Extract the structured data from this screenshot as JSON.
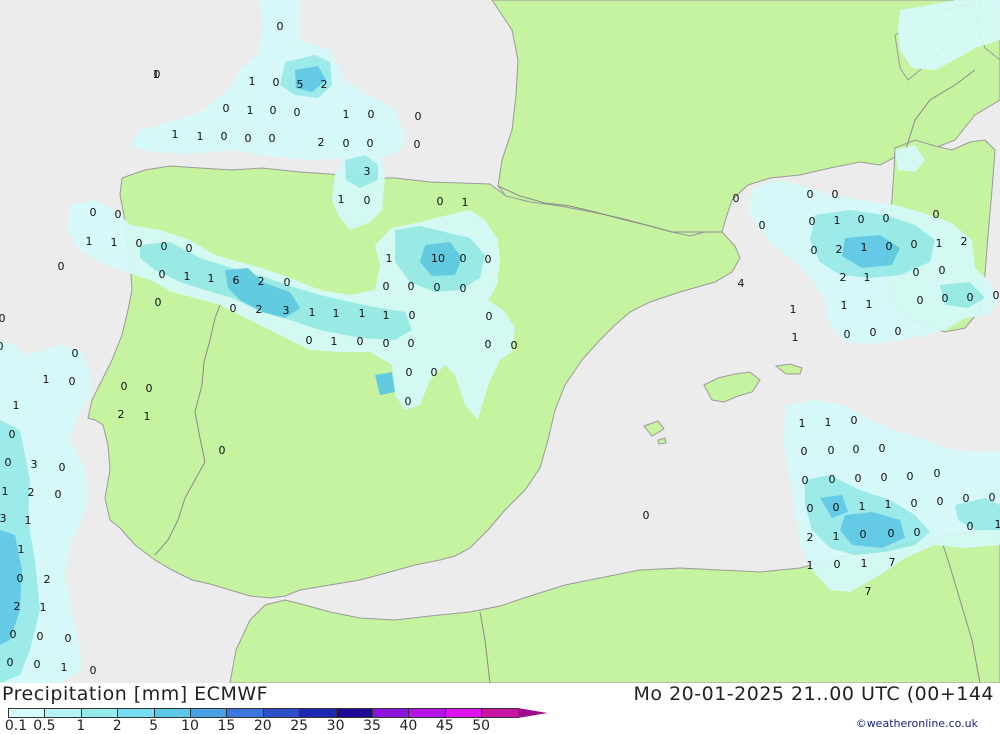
{
  "title": "Precipitation [mm] ECMWF",
  "datetime": "Mo 20-01-2025 21..00 UTC (00+144",
  "credit": "©weatheronline.co.uk",
  "colors": {
    "sea": "#ececec",
    "land": "#c6f3a0",
    "coast": "#9a9a9a",
    "border": "#8a8a8a"
  },
  "legend": {
    "ticks": [
      "0.1",
      "0.5",
      "1",
      "2",
      "5",
      "10",
      "15",
      "20",
      "25",
      "30",
      "35",
      "40",
      "45",
      "50"
    ],
    "colors": [
      "#d6fafa",
      "#b4f3f3",
      "#96eaea",
      "#78dcf0",
      "#5ac8e6",
      "#4aa0e6",
      "#3c78dc",
      "#2d50c8",
      "#1e28b4",
      "#1e0a96",
      "#8c14dc",
      "#b414e6",
      "#dc14f0",
      "#c814a0",
      "#a00a8c"
    ]
  },
  "labels": [
    {
      "t": "0"
    },
    {
      "t": "0"
    },
    {
      "t": "1"
    },
    {
      "t": "0"
    },
    {
      "t": "5"
    },
    {
      "t": "2"
    },
    {
      "t": "0"
    },
    {
      "t": "1"
    },
    {
      "t": "0"
    },
    {
      "t": "0"
    },
    {
      "t": "1"
    },
    {
      "t": "0"
    },
    {
      "t": "0"
    },
    {
      "t": "1"
    },
    {
      "t": "1"
    },
    {
      "t": "0"
    },
    {
      "t": "0"
    },
    {
      "t": "0"
    },
    {
      "t": "2"
    },
    {
      "t": "0"
    },
    {
      "t": "0"
    },
    {
      "t": "0"
    },
    {
      "t": "3"
    },
    {
      "t": "1"
    },
    {
      "t": "0"
    },
    {
      "t": "0"
    },
    {
      "t": "1"
    },
    {
      "t": "0"
    },
    {
      "t": "0"
    },
    {
      "t": "1"
    },
    {
      "t": "1"
    },
    {
      "t": "0"
    },
    {
      "t": "0"
    },
    {
      "t": "0"
    },
    {
      "t": "0"
    },
    {
      "t": "1"
    },
    {
      "t": "10"
    },
    {
      "t": "0"
    },
    {
      "t": "0"
    },
    {
      "t": "0"
    },
    {
      "t": "1"
    },
    {
      "t": "1"
    },
    {
      "t": "6"
    },
    {
      "t": "2"
    },
    {
      "t": "0"
    },
    {
      "t": "0"
    },
    {
      "t": "0"
    },
    {
      "t": "0"
    },
    {
      "t": "0"
    },
    {
      "t": "0"
    },
    {
      "t": "0"
    },
    {
      "t": "2"
    },
    {
      "t": "3"
    },
    {
      "t": "1"
    },
    {
      "t": "1"
    },
    {
      "t": "1"
    },
    {
      "t": "1"
    },
    {
      "t": "0"
    },
    {
      "t": "0"
    },
    {
      "t": "0"
    },
    {
      "t": "0"
    },
    {
      "t": "0"
    },
    {
      "t": "1"
    },
    {
      "t": "0"
    },
    {
      "t": "0"
    },
    {
      "t": "0"
    },
    {
      "t": "0"
    },
    {
      "t": "0"
    },
    {
      "t": "0"
    },
    {
      "t": "1"
    },
    {
      "t": "0"
    },
    {
      "t": "0"
    },
    {
      "t": "0"
    },
    {
      "t": "0"
    },
    {
      "t": "0"
    },
    {
      "t": "0"
    },
    {
      "t": "1"
    },
    {
      "t": "2"
    },
    {
      "t": "1"
    },
    {
      "t": "0"
    },
    {
      "t": "0"
    },
    {
      "t": "0"
    },
    {
      "t": "3"
    },
    {
      "t": "0"
    },
    {
      "t": "1"
    },
    {
      "t": "2"
    },
    {
      "t": "0"
    },
    {
      "t": "3"
    },
    {
      "t": "1"
    },
    {
      "t": "1"
    },
    {
      "t": "0"
    },
    {
      "t": "2"
    },
    {
      "t": "2"
    },
    {
      "t": "1"
    },
    {
      "t": "0"
    },
    {
      "t": "0"
    },
    {
      "t": "0"
    },
    {
      "t": "0"
    },
    {
      "t": "0"
    },
    {
      "t": "1"
    },
    {
      "t": "0"
    },
    {
      "t": "1"
    },
    {
      "t": "0"
    },
    {
      "t": "0"
    },
    {
      "t": "0"
    },
    {
      "t": "0"
    },
    {
      "t": "0"
    },
    {
      "t": "1"
    },
    {
      "t": "0"
    },
    {
      "t": "0"
    },
    {
      "t": "0"
    },
    {
      "t": "0"
    },
    {
      "t": "2"
    },
    {
      "t": "1"
    },
    {
      "t": "0"
    },
    {
      "t": "0"
    },
    {
      "t": "1"
    },
    {
      "t": "2"
    },
    {
      "t": "4"
    },
    {
      "t": "2"
    },
    {
      "t": "1"
    },
    {
      "t": "0"
    },
    {
      "t": "0"
    },
    {
      "t": "1"
    },
    {
      "t": "1"
    },
    {
      "t": "1"
    },
    {
      "t": "0"
    },
    {
      "t": "0"
    },
    {
      "t": "0"
    },
    {
      "t": "0"
    },
    {
      "t": "1"
    },
    {
      "t": "0"
    },
    {
      "t": "0"
    },
    {
      "t": "0"
    },
    {
      "t": "1"
    },
    {
      "t": "1"
    },
    {
      "t": "0"
    },
    {
      "t": "0"
    },
    {
      "t": "0"
    },
    {
      "t": "0"
    },
    {
      "t": "0"
    },
    {
      "t": "0"
    },
    {
      "t": "0"
    },
    {
      "t": "0"
    },
    {
      "t": "0"
    },
    {
      "t": "0"
    },
    {
      "t": "0"
    },
    {
      "t": "0"
    },
    {
      "t": "0"
    },
    {
      "t": "0"
    },
    {
      "t": "1"
    },
    {
      "t": "1"
    },
    {
      "t": "0"
    },
    {
      "t": "0"
    },
    {
      "t": "0"
    },
    {
      "t": "0"
    },
    {
      "t": "2"
    },
    {
      "t": "1"
    },
    {
      "t": "0"
    },
    {
      "t": "0"
    },
    {
      "t": "0"
    },
    {
      "t": "0"
    },
    {
      "t": "1"
    },
    {
      "t": "1"
    },
    {
      "t": "0"
    },
    {
      "t": "1"
    },
    {
      "t": "7"
    },
    {
      "t": "7"
    },
    {
      "t": "1"
    },
    {
      "t": "2"
    },
    {
      "t": "5"
    },
    {
      "t": "0"
    },
    {
      "t": "0"
    },
    {
      "t": "2"
    },
    {
      "t": "1"
    },
    {
      "t": "0"
    },
    {
      "t": "0"
    },
    {
      "t": "0"
    }
  ]
}
